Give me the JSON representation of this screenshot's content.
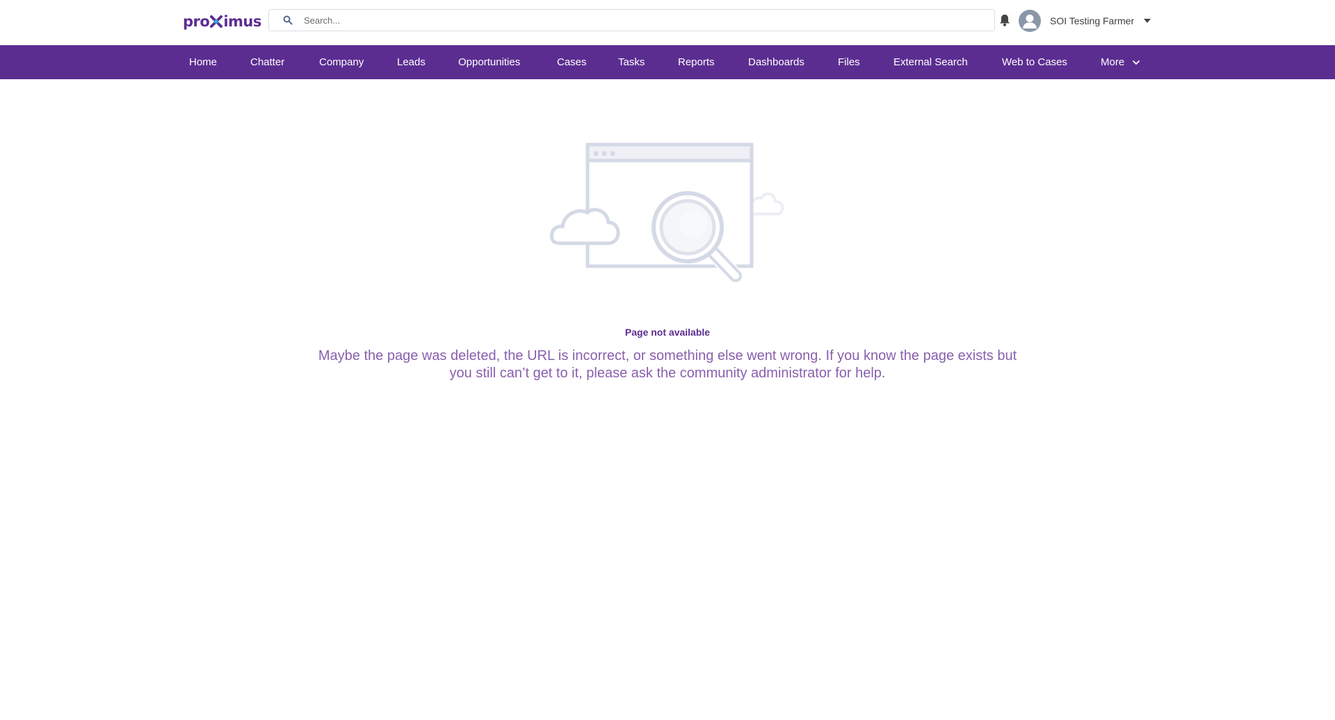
{
  "header": {
    "logo_text_left": "pro",
    "logo_text_right": "imus",
    "search": {
      "placeholder": "Search..."
    },
    "user": {
      "name": "SOI Testing Farmer"
    }
  },
  "nav": {
    "items": [
      {
        "label": "Home"
      },
      {
        "label": "Chatter"
      },
      {
        "label": "Company"
      },
      {
        "label": "Leads"
      },
      {
        "label": "Opportunities"
      },
      {
        "label": "Cases"
      },
      {
        "label": "Tasks"
      },
      {
        "label": "Reports"
      },
      {
        "label": "Dashboards"
      },
      {
        "label": "Files"
      },
      {
        "label": "External Search"
      },
      {
        "label": "Web to Cases"
      },
      {
        "label": "More"
      }
    ]
  },
  "error": {
    "title": "Page not available",
    "message": "Maybe the page was deleted, the URL is incorrect, or something else went wrong. If you know the page exists but you still can’t get to it, please ask the community administrator for help."
  },
  "colors": {
    "brand": "#5c2d91",
    "message": "#8a5fae",
    "illustration": "#d4d9e6"
  },
  "icons": [
    "proximus-logo",
    "search-icon",
    "bell-icon",
    "avatar-icon",
    "caret-down-icon",
    "chevron-down-icon",
    "page-not-found-illustration"
  ]
}
